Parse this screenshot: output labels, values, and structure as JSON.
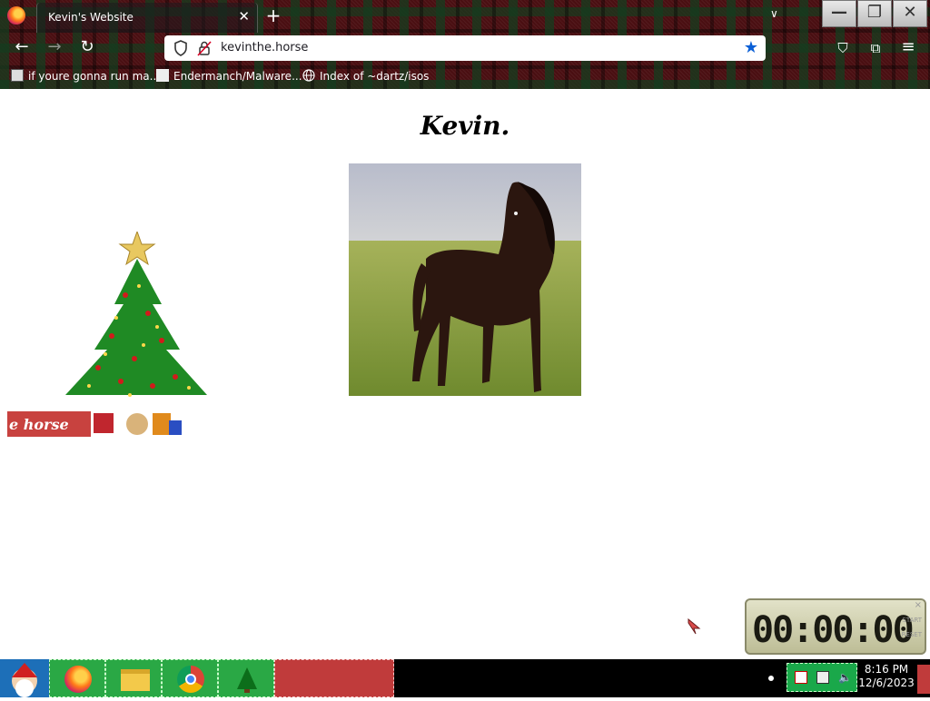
{
  "browser": {
    "tab_title": "Kevin's Website",
    "tab_close": "✕",
    "new_tab": "+",
    "tab_list": "∨",
    "window_minimize": "—",
    "window_restore": "❐",
    "window_close": "✕",
    "back": "←",
    "forward": "→",
    "reload": "↻",
    "url": "kevinthe.horse",
    "bookmark_star": "★",
    "pocket": "⛉",
    "extensions": "⧉",
    "menu": "≡",
    "bookmarks": [
      {
        "label": "if youre gonna run ma...",
        "icon": "computer-icon"
      },
      {
        "label": "Endermanch/Malware...",
        "icon": "github-icon"
      },
      {
        "label": "Index of ~dartz/isos",
        "icon": "globe-icon"
      }
    ]
  },
  "page": {
    "title": "Kevin.",
    "tree_banner": "e horse"
  },
  "timer": {
    "display": "00:00:00",
    "start_label": "START",
    "reset_label": "RESET",
    "close": "×"
  },
  "taskbar": {
    "clock_time": "8:16 PM",
    "clock_date": "12/6/2023",
    "apps": [
      "santa-start",
      "firefox",
      "file-explorer",
      "chrome",
      "christmas-tree"
    ]
  },
  "colors": {
    "accent_star": "#0a5fd6",
    "tartan_base": "#4a0f12",
    "taskbar_green": "#1aa84a",
    "taskbar_red": "#c03b3b"
  }
}
